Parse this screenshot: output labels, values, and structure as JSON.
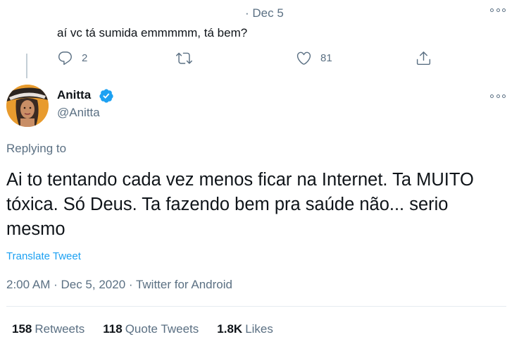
{
  "parent_tweet": {
    "meta": "· Dec 5",
    "text": "aí vc tá sumida emmmmm, tá bem?",
    "replies": "2",
    "retweets": "",
    "likes": "81"
  },
  "tweet": {
    "author_name": "Anitta",
    "author_handle": "@Anitta",
    "replying_to": "Replying to",
    "text": "Ai to tentando cada vez menos ficar na Internet. Ta MUITO tóxica. Só Deus. Ta fazendo bem pra saúde não... serio mesmo",
    "translate_label": "Translate Tweet",
    "timestamp": "2:00 AM · Dec 5, 2020 · Twitter for Android"
  },
  "stats": {
    "retweets_count": "158",
    "retweets_label": "Retweets",
    "quote_count": "118",
    "quote_label": "Quote Tweets",
    "likes_count": "1.8K",
    "likes_label": "Likes"
  },
  "icons": {
    "reply": "reply-icon",
    "retweet": "retweet-icon",
    "like": "heart-icon",
    "share": "share-icon",
    "more": "more-icon",
    "verified": "verified-badge-icon"
  },
  "colors": {
    "accent": "#1da1f2",
    "secondary_text": "#5b7083",
    "primary_text": "#0f1419"
  }
}
